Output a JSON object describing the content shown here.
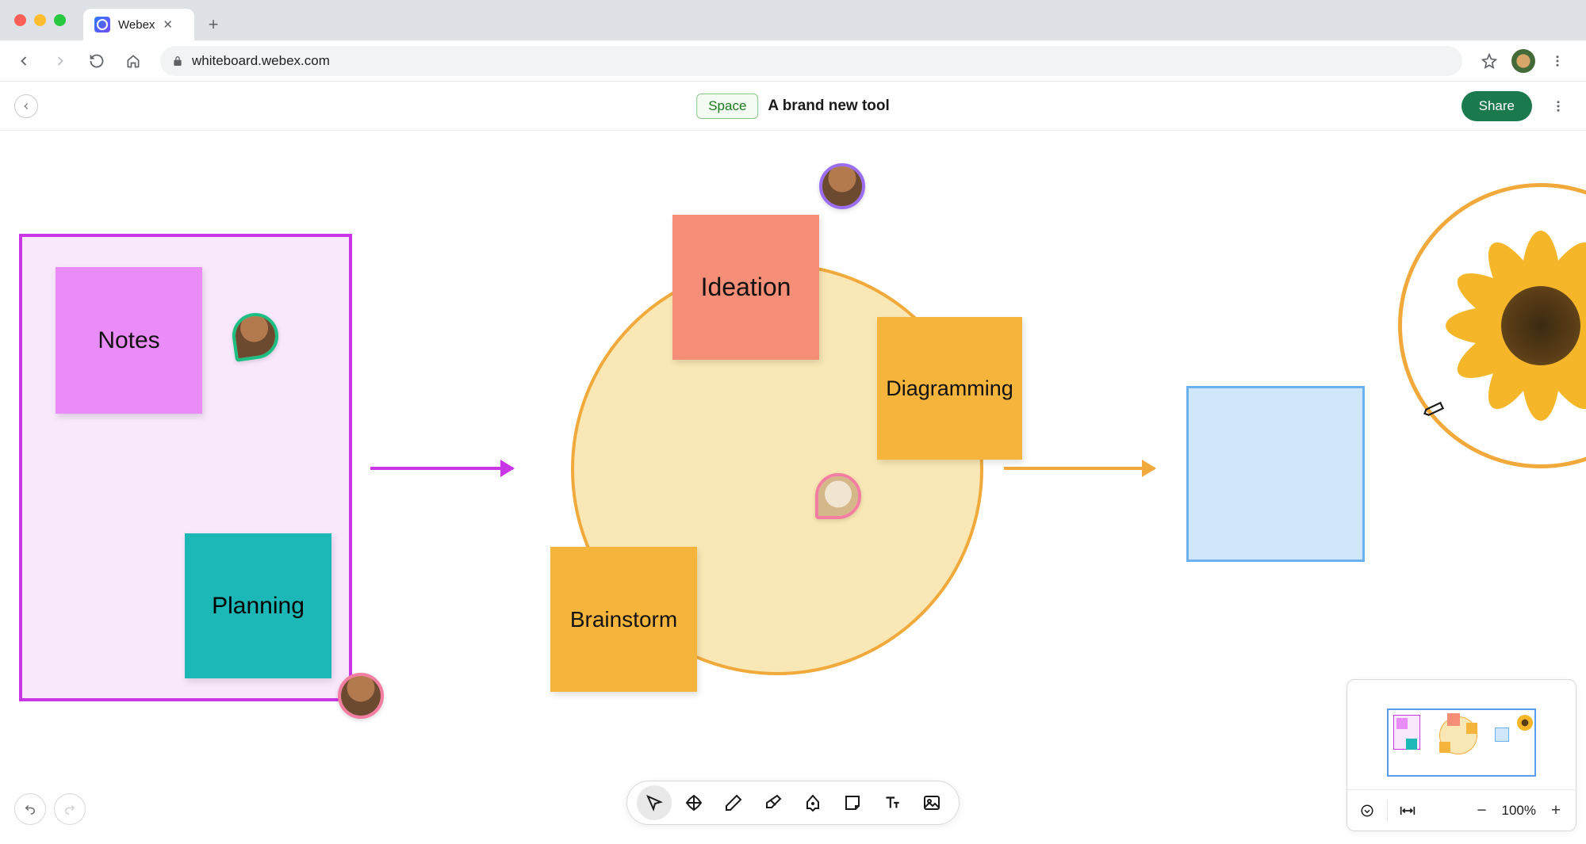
{
  "browser": {
    "tab_title": "Webex",
    "url": "whiteboard.webex.com"
  },
  "header": {
    "back_label": "Back",
    "space_label": "Space",
    "board_title": "A brand new tool",
    "share_label": "Share"
  },
  "stickies": {
    "notes": "Notes",
    "planning": "Planning",
    "ideation": "Ideation",
    "diagramming": "Diagramming",
    "brainstorm": "Brainstorm"
  },
  "collaborators": {
    "green": "collaborator-1",
    "pink": "collaborator-2",
    "purple": "collaborator-3",
    "pink2": "collaborator-4"
  },
  "toolbar": {
    "select": "Select",
    "pan": "Pan",
    "pen": "Pen",
    "eraser": "Eraser",
    "fill": "Shape",
    "sticky": "Sticky note",
    "text": "Text",
    "image": "Image"
  },
  "zoom": {
    "percent": "100%"
  },
  "colors": {
    "magenta": "#c936e6",
    "orange": "#f2a93b",
    "share_green": "#1a7a4e"
  }
}
